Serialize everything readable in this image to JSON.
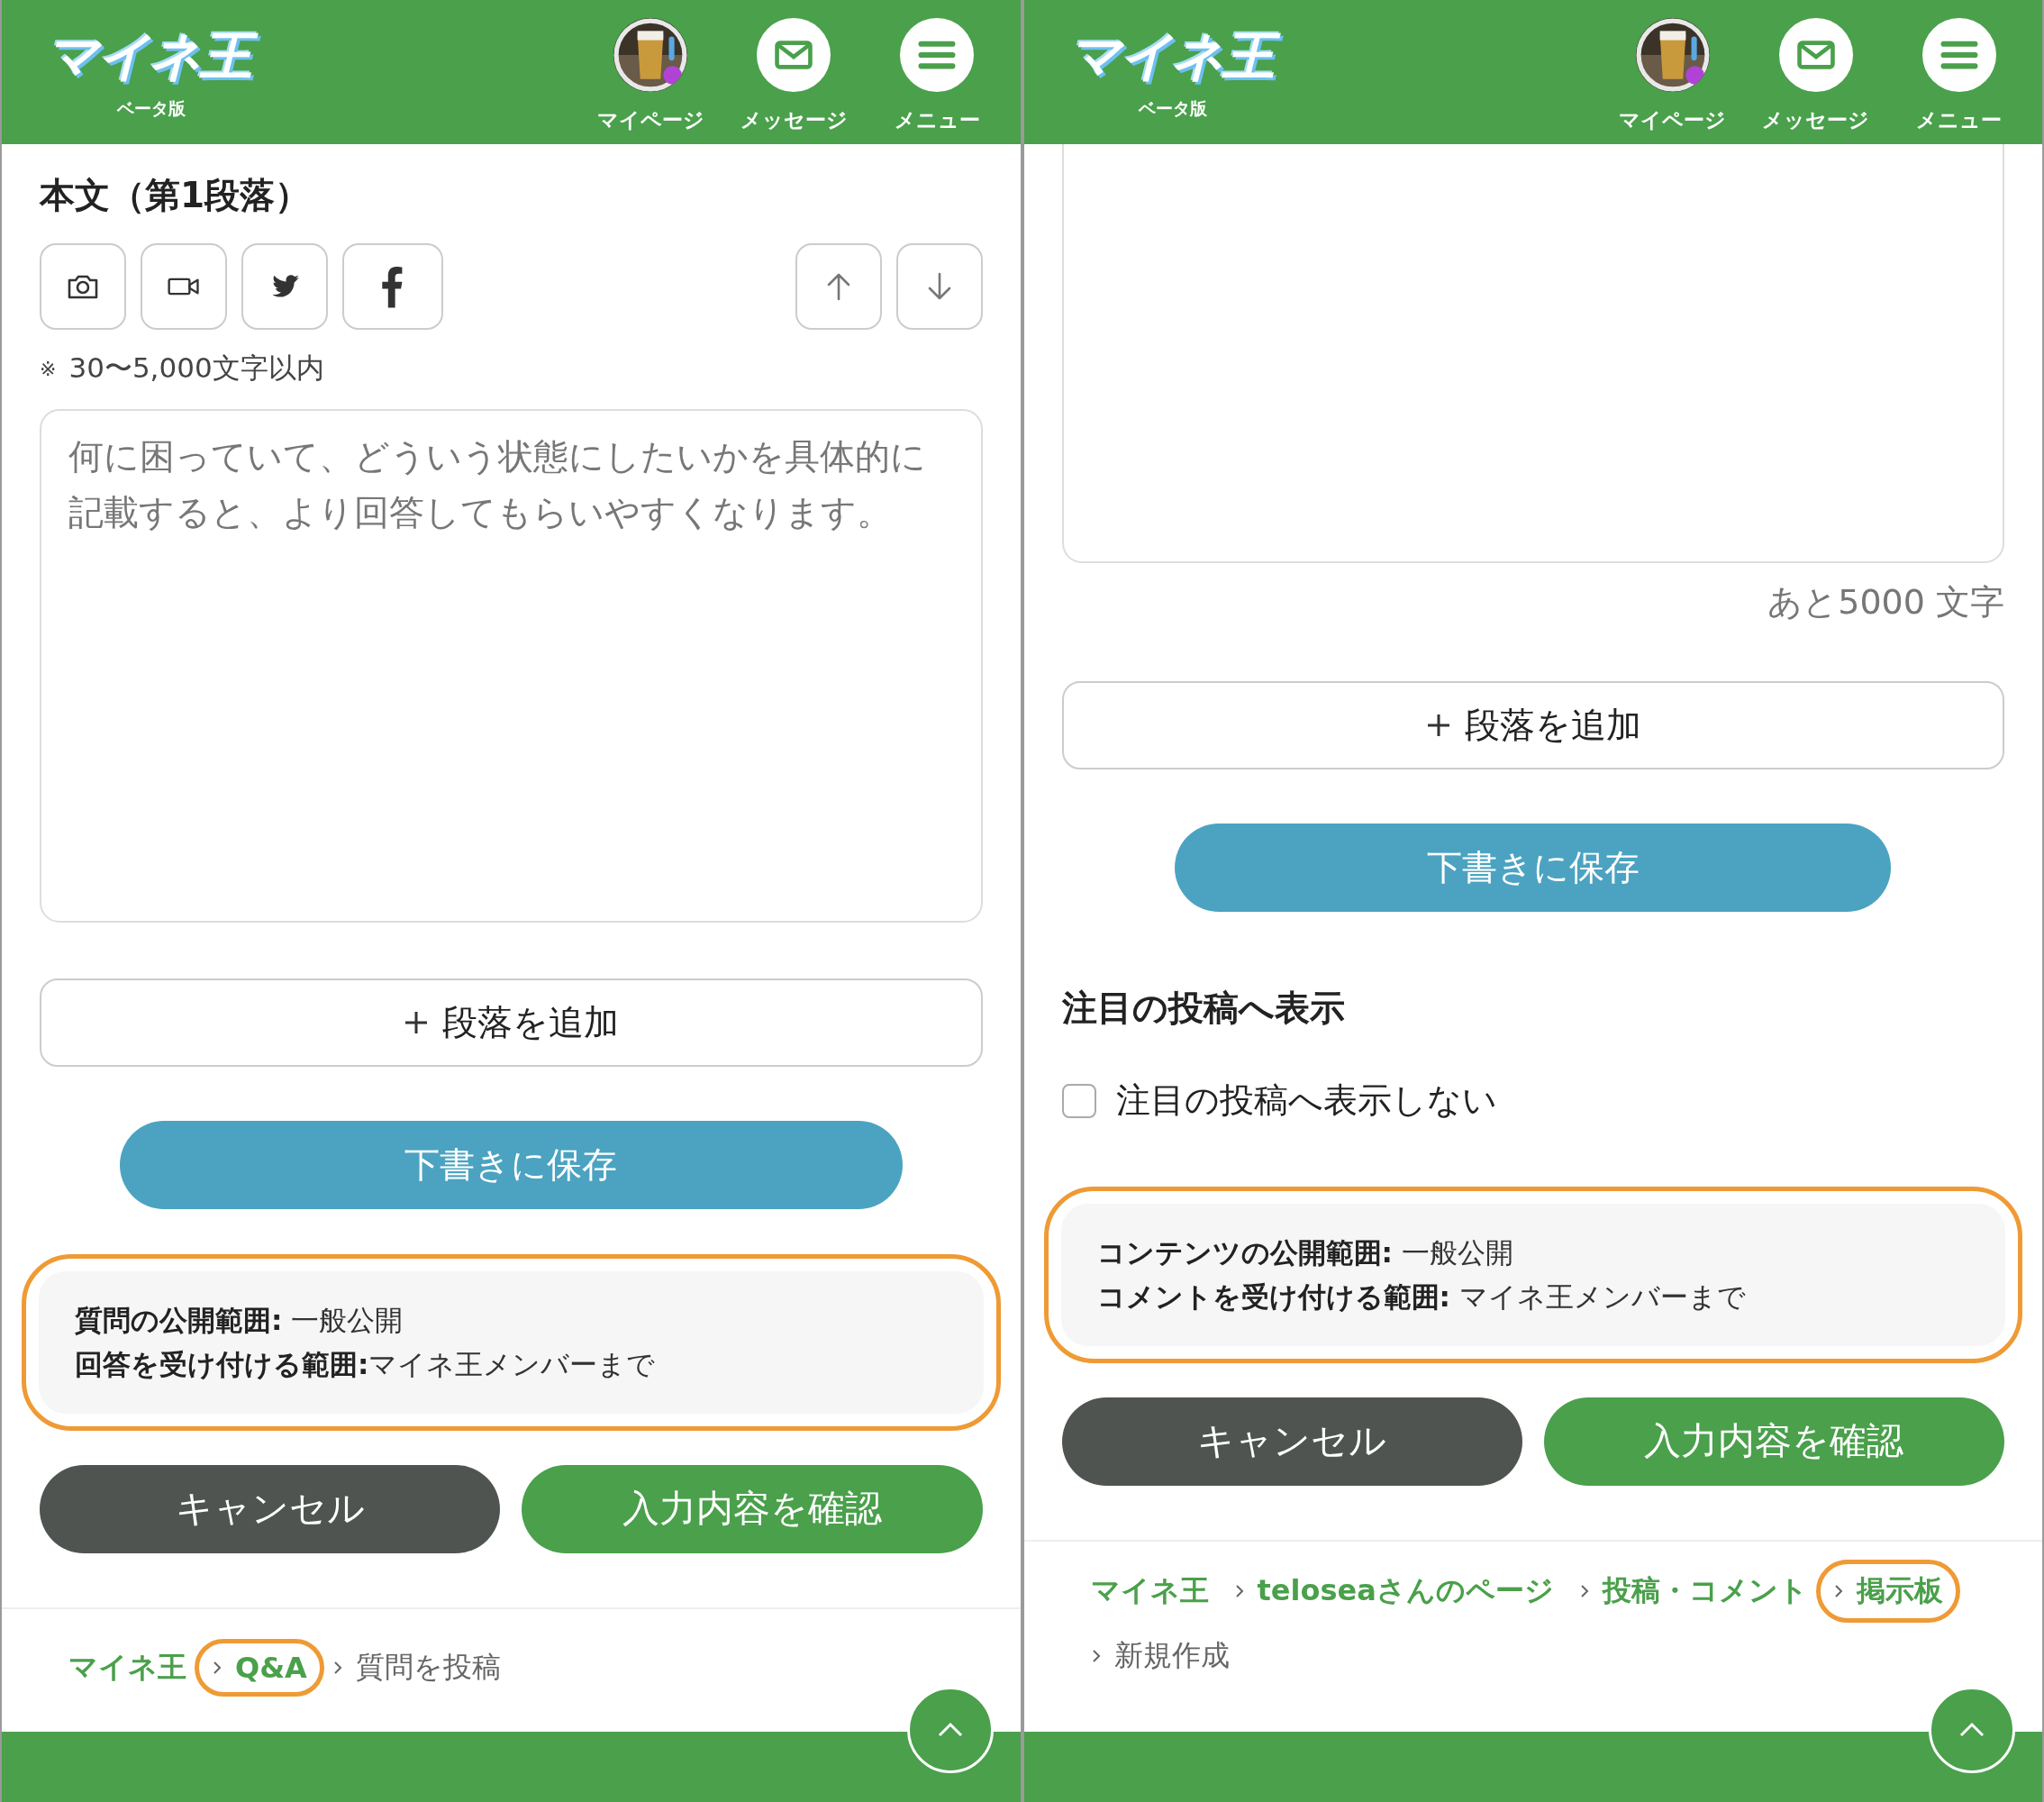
{
  "screens": [
    {
      "header": {
        "logo": "マイネ王",
        "logo_sub": "ベータ版",
        "nav": [
          {
            "label": "マイページ",
            "kind": "avatar"
          },
          {
            "label": "メッセージ",
            "kind": "mail"
          },
          {
            "label": "メニュー",
            "kind": "menu"
          }
        ]
      },
      "blocks": [
        {
          "kind": "heading",
          "text": "本文（第1段落）"
        },
        {
          "kind": "toolbar",
          "media": [
            {
              "kind": "camera"
            },
            {
              "kind": "video"
            },
            {
              "kind": "twitter"
            },
            {
              "kind": "facebook"
            }
          ],
          "move": [
            {
              "kind": "up"
            },
            {
              "kind": "down"
            }
          ]
        },
        {
          "kind": "note",
          "mark": "※",
          "text": "30〜5,000文字以内"
        },
        {
          "kind": "textarea",
          "continued": false,
          "placeholder": "何に困っていて、どういう状態にしたいかを具体的に記載すると、より回答してもらいやすくなります。"
        },
        {
          "kind": "add_button",
          "text": "段落を追加"
        },
        {
          "kind": "save_button",
          "text": "下書きに保存"
        },
        {
          "kind": "info",
          "highlighted": true,
          "lines": [
            "**質問の公開範囲:** 一般公開",
            "**回答を受け付ける範囲:**マイネ王メンバーまで"
          ]
        },
        {
          "kind": "actions",
          "cancel": "キャンセル",
          "confirm": "入力内容を確認"
        },
        {
          "kind": "breadcrumb",
          "items": [
            {
              "label": "マイネ王",
              "current": false,
              "highlighted": false
            },
            {
              "label": "Q&A",
              "current": false,
              "highlighted": true
            },
            {
              "label": "質問を投稿",
              "current": true,
              "highlighted": false
            }
          ]
        }
      ]
    },
    {
      "header": {
        "logo": "マイネ王",
        "logo_sub": "ベータ版",
        "nav": [
          {
            "label": "マイページ",
            "kind": "avatar"
          },
          {
            "label": "メッセージ",
            "kind": "mail"
          },
          {
            "label": "メニュー",
            "kind": "menu"
          }
        ]
      },
      "blocks": [
        {
          "kind": "textarea",
          "continued": true
        },
        {
          "kind": "counter",
          "text": "あと5000 文字"
        },
        {
          "kind": "add_button",
          "text": "段落を追加"
        },
        {
          "kind": "save_button",
          "text": "下書きに保存"
        },
        {
          "kind": "heading",
          "text": "注目の投稿へ表示"
        },
        {
          "kind": "checkbox",
          "label": "注目の投稿へ表示しない",
          "checked": false
        },
        {
          "kind": "info",
          "highlighted": true,
          "lines": [
            "**コンテンツの公開範囲:** 一般公開",
            "**コメントを受け付ける範囲:** マイネ王メンバーまで"
          ]
        },
        {
          "kind": "actions",
          "cancel": "キャンセル",
          "confirm": "入力内容を確認"
        },
        {
          "kind": "breadcrumb",
          "items": [
            {
              "label": "マイネ王",
              "current": false,
              "highlighted": false
            },
            {
              "label": "teloseaさんのページ",
              "current": false,
              "highlighted": false
            },
            {
              "label": "投稿・コメント",
              "current": false,
              "highlighted": false
            },
            {
              "label": "掲示板",
              "current": false,
              "highlighted": true
            },
            {
              "label": "新規作成",
              "current": true,
              "highlighted": false
            }
          ]
        }
      ]
    }
  ]
}
